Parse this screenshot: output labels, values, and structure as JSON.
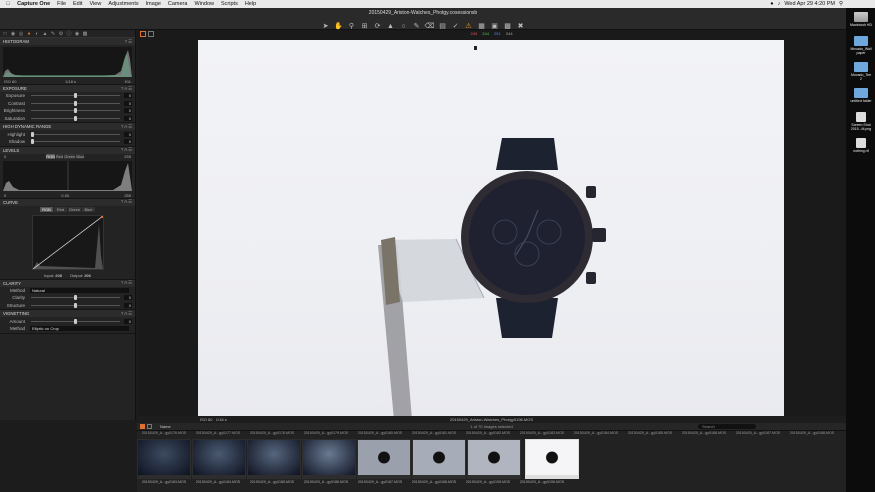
{
  "menubar": {
    "apple": "",
    "app": "Capture One",
    "items": [
      "File",
      "Edit",
      "View",
      "Adjustments",
      "Image",
      "Camera",
      "Window",
      "Scripts",
      "Help"
    ],
    "clock": "Wed Apr 29  4:20 PM"
  },
  "window": {
    "title": "20150429_Ariston-Watches_Photgy.cosessionsb"
  },
  "toolbar": {
    "icons": [
      "cursor-icon",
      "pan-icon",
      "loupe-icon",
      "crop-icon",
      "rotate-icon",
      "keystone-icon",
      "spot-icon",
      "brush-icon",
      "erase-icon",
      "gradient-icon",
      "picker-icon",
      "warning-icon",
      "grid-icon",
      "guides-icon",
      "proof-icon",
      "tools-icon"
    ]
  },
  "histogram": {
    "title": "HISTOGRAM",
    "iso": "ISO 80",
    "shutter": "1/18 s",
    "aperture": "f/11"
  },
  "exposure": {
    "title": "EXPOSURE",
    "rows": [
      {
        "label": "Exposure",
        "value": "0"
      },
      {
        "label": "Contrast",
        "value": "0"
      },
      {
        "label": "Brightness",
        "value": "0"
      },
      {
        "label": "Saturation",
        "value": "0"
      }
    ]
  },
  "hdr": {
    "title": "HIGH DYNAMIC RANGE",
    "rows": [
      {
        "label": "Highlight",
        "value": "0"
      },
      {
        "label": "Shadow",
        "value": "0"
      }
    ]
  },
  "levels": {
    "title": "LEVELS",
    "low": "0",
    "high": "255",
    "mid": "0.00",
    "tabs": [
      "RGB",
      "Red",
      "Green",
      "Blue"
    ],
    "left_num": "0",
    "right_num": "255"
  },
  "curve": {
    "title": "CURVE",
    "tabs": [
      "RGB",
      "Red",
      "Green",
      "Blue"
    ],
    "input_label": "Input:",
    "input_value": "208",
    "output_label": "Output:",
    "output_value": "206"
  },
  "clarity": {
    "title": "CLARITY",
    "method_label": "Method",
    "method_value": "Natural",
    "rows": [
      {
        "label": "Clarity",
        "value": "0"
      },
      {
        "label": "Structure",
        "value": "0"
      }
    ]
  },
  "vignetting": {
    "title": "VIGNETTING",
    "amount_label": "Amount",
    "amount_value": "0",
    "method_label": "Method",
    "method_value": "Elliptic on Crop"
  },
  "viewer": {
    "color_values": [
      "243",
      "244",
      "251",
      "244"
    ],
    "status_iso": "ISO 80",
    "status_shutter": "1/18 s",
    "status_filename": "20150429_Ariston-Watches_Photgy0196.MOS"
  },
  "filmstrip": {
    "sort_label": "Name",
    "count": "1 of 70 Images selected",
    "search_placeholder": "Search",
    "top_names": [
      "20150429_A...gy0176.MOS",
      "20150429_A...gy0177.MOS",
      "20150429_A...gy0178.MOS",
      "20150429_A...gy0179.MOS",
      "20150429_A...gy0180.MOS",
      "20150429_A...gy0181.MOS",
      "20150429_A...gy0182.MOS",
      "20150429_A...gy0183.MOS",
      "20150429_A...gy0184.MOS",
      "20150429_A...gy0185.MOS",
      "20150429_A...gy0186.MOS",
      "20150429_A...gy0187.MOS",
      "20150429_A...gy0188.MOS"
    ],
    "thumb_names": [
      "20150429_A...gy0183.MOS",
      "20150429_A...gy0184.MOS",
      "20150429_A...gy0185.MOS",
      "20150429_A...gy0186.MOS",
      "20150429_A...gy0187.MOS",
      "20150429_A...gy0188.MOS",
      "20150429_A...gy0195.MOS",
      "20150429_A...gy0196.MOS"
    ]
  },
  "desktop": {
    "items": [
      {
        "label": "Macintosh HD",
        "kind": "drive"
      },
      {
        "label": "Movado_Wall paper",
        "kind": "folder"
      },
      {
        "label": "Movado_Tee 2",
        "kind": "folder"
      },
      {
        "label": "untitled folder",
        "kind": "folder"
      },
      {
        "label": "Screen Shot 2015...M.png",
        "kind": "file"
      },
      {
        "label": "nothing.rtf",
        "kind": "file"
      }
    ]
  }
}
